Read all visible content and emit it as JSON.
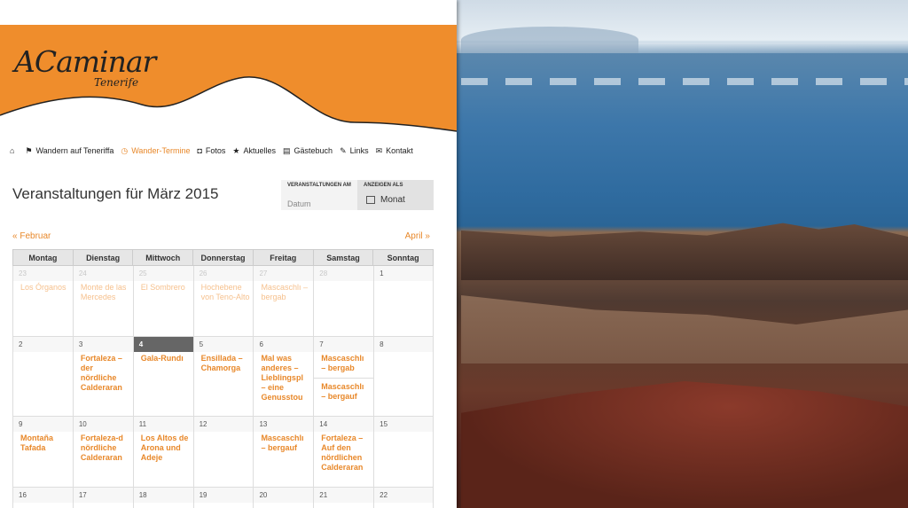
{
  "site": {
    "logo": "ACaminar",
    "logo_sub": "Tenerife"
  },
  "nav": [
    {
      "icon": "⌂",
      "label": ""
    },
    {
      "icon": "⚑",
      "label": "Wandern auf Teneriffa"
    },
    {
      "icon": "◷",
      "label": "Wander-Termine"
    },
    {
      "icon": "◘",
      "label": "Fotos"
    },
    {
      "icon": "★",
      "label": "Aktuelles"
    },
    {
      "icon": "▤",
      "label": "Gästebuch"
    },
    {
      "icon": "✎",
      "label": "Links"
    },
    {
      "icon": "✉",
      "label": "Kontakt"
    }
  ],
  "page_title": "Veranstaltungen für März 2015",
  "filter": {
    "date_label": "VERANSTALTUNGEN AM",
    "date_placeholder": "Datum",
    "view_label": "ANZEIGEN ALS",
    "view_value": "Monat"
  },
  "pager": {
    "prev": "« Februar",
    "next": "April »"
  },
  "weekdays": [
    "Montag",
    "Dienstag",
    "Mittwoch",
    "Donnerstag",
    "Freitag",
    "Samstag",
    "Sonntag"
  ],
  "weeks": [
    [
      {
        "num": "23",
        "past": true,
        "events": [
          "Los Órganos"
        ]
      },
      {
        "num": "24",
        "past": true,
        "events": [
          "Monte de las Mercedes"
        ]
      },
      {
        "num": "25",
        "past": true,
        "events": [
          "El Sombrero"
        ]
      },
      {
        "num": "26",
        "past": true,
        "events": [
          "Hochebene von Teno-Alto"
        ]
      },
      {
        "num": "27",
        "past": true,
        "events": [
          "Mascaschlı – bergab"
        ]
      },
      {
        "num": "28",
        "past": true,
        "events": []
      },
      {
        "num": "1",
        "events": []
      }
    ],
    [
      {
        "num": "2",
        "events": []
      },
      {
        "num": "3",
        "events": [
          "Fortaleza – der nördliche Calderaran"
        ]
      },
      {
        "num": "4",
        "today": true,
        "events": [
          "Gala-Rundı"
        ]
      },
      {
        "num": "5",
        "events": [
          "Ensillada – Chamorga"
        ]
      },
      {
        "num": "6",
        "events": [
          "Mal was anderes – Lieblingspl – eine Genusstou"
        ]
      },
      {
        "num": "7",
        "events": [
          "Mascaschlı – bergab",
          "Mascaschlı – bergauf"
        ]
      },
      {
        "num": "8",
        "events": []
      }
    ],
    [
      {
        "num": "9",
        "events": [
          "Montaña Tafada"
        ]
      },
      {
        "num": "10",
        "events": [
          "Fortaleza-d nördliche Calderaran"
        ]
      },
      {
        "num": "11",
        "events": [
          "Los Altos de Arona und Adeje"
        ]
      },
      {
        "num": "12",
        "events": []
      },
      {
        "num": "13",
        "events": [
          "Mascaschlı – bergauf"
        ]
      },
      {
        "num": "14",
        "events": [
          "Fortaleza – Auf den nördlichen Calderaran"
        ]
      },
      {
        "num": "15",
        "events": []
      }
    ],
    [
      {
        "num": "16",
        "events": []
      },
      {
        "num": "17",
        "events": []
      },
      {
        "num": "18",
        "events": []
      },
      {
        "num": "19",
        "events": []
      },
      {
        "num": "20",
        "events": []
      },
      {
        "num": "21",
        "events": []
      },
      {
        "num": "22",
        "events": []
      }
    ]
  ],
  "colors": {
    "accent": "#e8882a",
    "header": "#ef8d2c"
  }
}
